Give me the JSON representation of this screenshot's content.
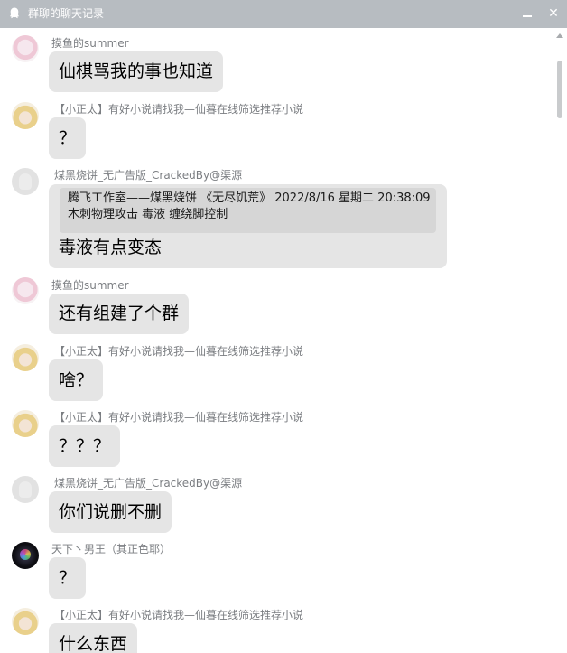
{
  "window": {
    "title": "群聊的聊天记录",
    "minimize_icon": "minimize-icon",
    "close_icon": "close-icon"
  },
  "messages": [
    {
      "sender": "摸鱼的summer",
      "avatar": "avatar-pink-anime",
      "text": "仙棋骂我的事也知道"
    },
    {
      "sender": "【小正太】有好小说请找我—仙暮在线筛选推荐小说",
      "avatar": "avatar-blonde-anime",
      "text": "？"
    },
    {
      "sender": "煤黑烧饼_无广告版_CrackedBy@渠源",
      "avatar": "avatar-default-gray",
      "quote": {
        "line1": "腾飞工作室——煤黑烧饼 《无尽饥荒》 2022/8/16 星期二 20:38:09",
        "line2": "木刺物理攻击 毒液 缠绕脚控制"
      },
      "text": "毒液有点变态"
    },
    {
      "sender": "摸鱼的summer",
      "avatar": "avatar-pink-anime",
      "text": "还有组建了个群"
    },
    {
      "sender": "【小正太】有好小说请找我—仙暮在线筛选推荐小说",
      "avatar": "avatar-blonde-anime",
      "text": "啥？"
    },
    {
      "sender": "【小正太】有好小说请找我—仙暮在线筛选推荐小说",
      "avatar": "avatar-blonde-anime",
      "text": "？？？"
    },
    {
      "sender": "煤黑烧饼_无广告版_CrackedBy@渠源",
      "avatar": "avatar-default-gray",
      "text": "你们说删不删"
    },
    {
      "sender": "天下丶男王（其正色耶）",
      "avatar": "avatar-dark-galaxy",
      "text": "？"
    },
    {
      "sender": "【小正太】有好小说请找我—仙暮在线筛选推荐小说",
      "avatar": "avatar-blonde-anime",
      "text": "什么东西"
    }
  ]
}
